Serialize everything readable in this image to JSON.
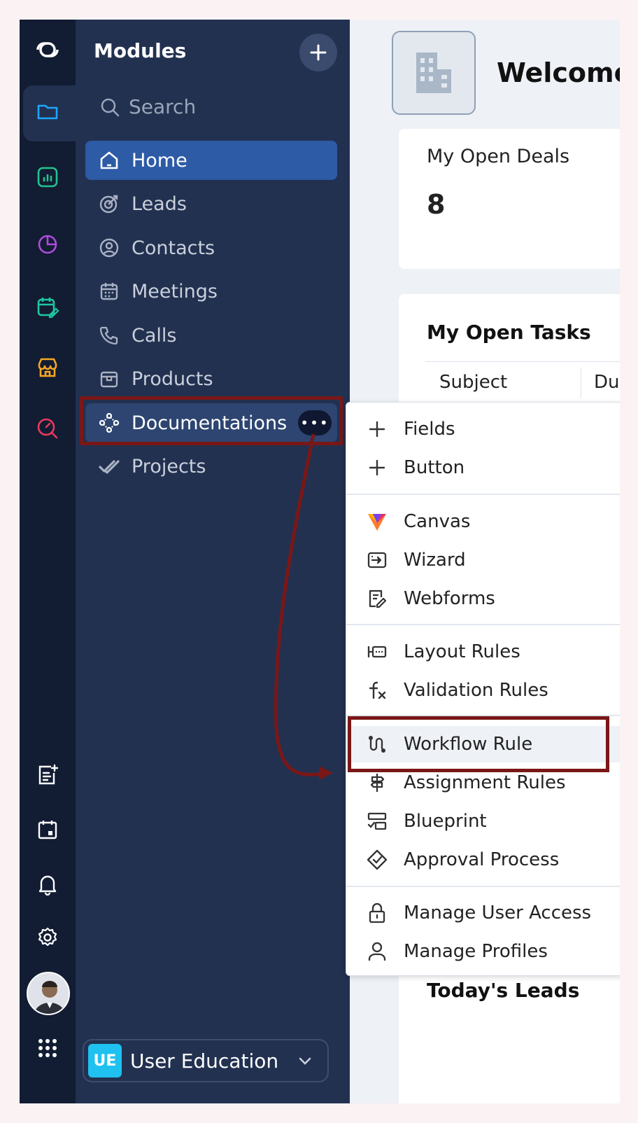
{
  "modules_panel": {
    "title": "Modules",
    "search_placeholder": "Search",
    "items": [
      {
        "label": "Home"
      },
      {
        "label": "Leads"
      },
      {
        "label": "Contacts"
      },
      {
        "label": "Meetings"
      },
      {
        "label": "Calls"
      },
      {
        "label": "Products"
      },
      {
        "label": "Documentations"
      },
      {
        "label": "Projects"
      }
    ],
    "active_item": "Home",
    "workspace": {
      "badge": "UE",
      "name": "User Education"
    }
  },
  "main": {
    "welcome": "Welcome",
    "open_deals": {
      "title": "My Open Deals",
      "count": "8"
    },
    "open_tasks": {
      "title": "My Open Tasks",
      "columns": [
        "Subject",
        "Du"
      ]
    },
    "todays_leads": {
      "title": "Today's Leads"
    }
  },
  "context_menu": {
    "groups": [
      [
        "Fields",
        "Button"
      ],
      [
        "Canvas",
        "Wizard",
        "Webforms"
      ],
      [
        "Layout Rules",
        "Validation Rules"
      ],
      [
        "Workflow Rule",
        "Assignment Rules",
        "Blueprint",
        "Approval Process"
      ],
      [
        "Manage User Access",
        "Manage Profiles"
      ]
    ],
    "highlighted": "Workflow Rule"
  },
  "colors": {
    "rail_bg": "#121c33",
    "panel_bg": "#223150",
    "active_item": "#2d5ba6",
    "highlight_border": "#7a1717",
    "workspace_badge": "#1fc1f0"
  }
}
